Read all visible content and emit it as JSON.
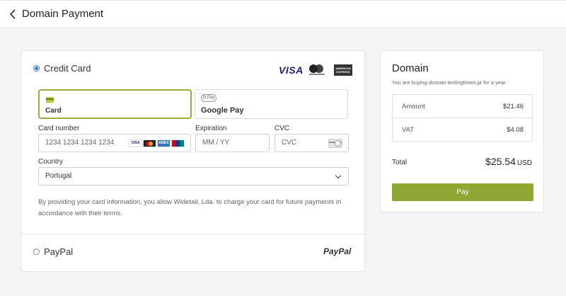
{
  "header": {
    "title": "Domain Payment"
  },
  "payment": {
    "credit_card_label": "Credit Card",
    "brands": {
      "visa": "VISA",
      "amex": "AMERICAN EXPRESS"
    },
    "tabs": [
      {
        "label": "Card",
        "icon": "card-icon",
        "active": true
      },
      {
        "label": "Google Pay",
        "icon": "google-pay-icon",
        "badge": "G Pay",
        "active": false
      }
    ],
    "card_number": {
      "label": "Card number",
      "placeholder": "1234 1234 1234 1234",
      "brand_icons": [
        "VISA",
        "mastercard",
        "AMEX",
        "unionpay"
      ]
    },
    "expiration": {
      "label": "Expiration",
      "placeholder": "MM / YY"
    },
    "cvc": {
      "label": "CVC",
      "placeholder": "CVC"
    },
    "country": {
      "label": "Country",
      "value": "Portugal"
    },
    "terms": "By providing your card information, you allow Widetail, Lda. to charge your card for future payments in accordance with their terms.",
    "paypal_label": "PayPal",
    "paypal_logo": "PayPal"
  },
  "summary": {
    "title": "Domain",
    "subtitle": "You are buying domain testingtimes.pt for a year.",
    "rows": [
      {
        "label": "Amount",
        "value": "$21.46"
      },
      {
        "label": "VAT",
        "value": "$4.08"
      }
    ],
    "total_label": "Total",
    "total_value": "$25.54",
    "currency": "USD",
    "pay_label": "Pay"
  },
  "colors": {
    "accent": "#8ea735",
    "active_border": "#9aab3a",
    "radio": "#3b7de0"
  }
}
